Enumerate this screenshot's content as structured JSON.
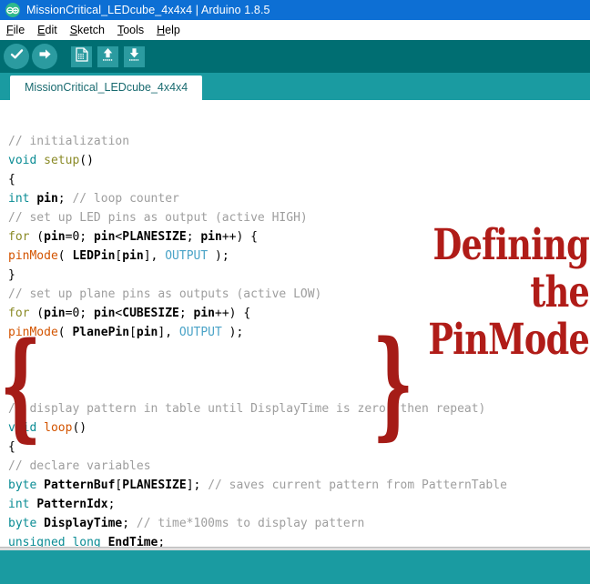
{
  "window": {
    "title": "MissionCritical_LEDcube_4x4x4 | Arduino 1.8.5",
    "logo_icon": "arduino-infinity-icon"
  },
  "menu": {
    "items": [
      {
        "label": "File",
        "mnemonic": "F",
        "rest": "ile"
      },
      {
        "label": "Edit",
        "mnemonic": "E",
        "rest": "dit"
      },
      {
        "label": "Sketch",
        "mnemonic": "S",
        "rest": "ketch"
      },
      {
        "label": "Tools",
        "mnemonic": "T",
        "rest": "ools"
      },
      {
        "label": "Help",
        "mnemonic": "H",
        "rest": "elp"
      }
    ]
  },
  "toolbar": {
    "buttons": [
      {
        "name": "verify-button",
        "icon": "check-icon",
        "tooltip": "Verify"
      },
      {
        "name": "upload-button",
        "icon": "right-arrow-icon",
        "tooltip": "Upload"
      },
      {
        "name": "new-sketch-button",
        "icon": "new-document-icon",
        "tooltip": "New"
      },
      {
        "name": "open-sketch-button",
        "icon": "up-arrow-icon",
        "tooltip": "Open"
      },
      {
        "name": "save-sketch-button",
        "icon": "down-arrow-icon",
        "tooltip": "Save"
      }
    ]
  },
  "tabs": [
    {
      "label": "MissionCritical_LEDcube_4x4x4",
      "active": true
    }
  ],
  "editor": {
    "lines": [
      "// initialization",
      "void setup()",
      "{",
      "int pin; // loop counter",
      "// set up LED pins as output (active HIGH)",
      "for (pin=0; pin<PLANESIZE; pin++) {",
      "pinMode( LEDPin[pin], OUTPUT );",
      "}",
      "// set up plane pins as outputs (active LOW)",
      "for (pin=0; pin<CUBESIZE; pin++) {",
      "pinMode( PlanePin[pin], OUTPUT );",
      "}",
      "}",
      "",
      "// display pattern in table until DisplayTime is zero (then repeat)",
      "void loop()",
      "{",
      "// declare variables",
      "byte PatternBuf[PLANESIZE]; // saves current pattern from PatternTable",
      "int PatternIdx;",
      "byte DisplayTime; // time*100ms to display pattern",
      "unsigned long EndTime;"
    ]
  },
  "annotation": {
    "line1": "Defining the",
    "line2": "PinMode",
    "brace_left": "{",
    "brace_right": "}",
    "color": "#b01c18"
  },
  "colors": {
    "titlebar": "#0d6fd4",
    "toolbar": "#006e72",
    "tabstrip": "#1a9ba1",
    "footer": "#1a9ba1",
    "icon_tile": "#2b9ba0",
    "comment": "#9e9e9e",
    "keyword": "#0a8c94",
    "function": "#8a8a26",
    "function_alt": "#d35400",
    "constant": "#4aa3c7",
    "annotation_red": "#b01c18"
  }
}
